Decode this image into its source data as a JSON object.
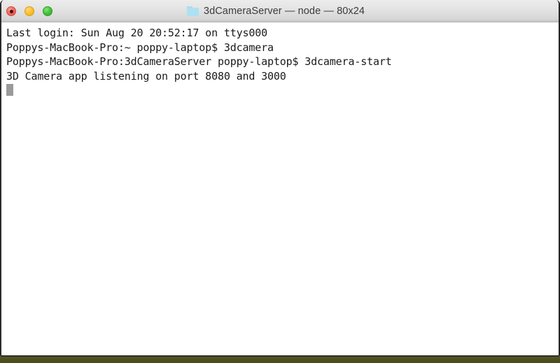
{
  "window": {
    "title": "3dCameraServer — node — 80x24",
    "folder_icon": "folder-icon",
    "controls": {
      "close_label": "close",
      "minimize_label": "minimize",
      "maximize_label": "maximize"
    }
  },
  "terminal": {
    "columns": 80,
    "rows": 24,
    "lines": [
      "Last login: Sun Aug 20 20:52:17 on ttys000",
      "Poppys-MacBook-Pro:~ poppy-laptop$ 3dcamera",
      "Poppys-MacBook-Pro:3dCameraServer poppy-laptop$ 3dcamera-start",
      "3D Camera app listening on port 8080 and 3000"
    ],
    "cursor": "block-cursor"
  },
  "colors": {
    "title_bar_top": "#ececec",
    "title_bar_bottom": "#c6c6c6",
    "terminal_background": "#ffffff",
    "terminal_text": "#1a1a1a",
    "cursor": "#9a9a9a",
    "desktop": "#4e5120",
    "close_button": "#f5695f",
    "minimize_button": "#fcc02e",
    "maximize_button": "#45c03a",
    "folder_icon": "#ade0f2"
  }
}
